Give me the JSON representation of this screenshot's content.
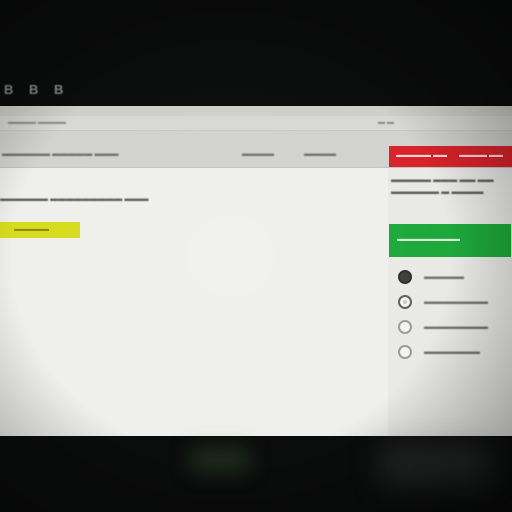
{
  "overlay": {
    "top_text": "B B B"
  },
  "browser": {
    "tabs": [
      "▬▬▬▬ ▬▬▬▬",
      "▬ ▬"
    ]
  },
  "toolbar": {
    "left_label": "▬▬▬▬▬▬ ▬▬▬▬▬ ▬▬▬",
    "mid_label": "▬▬▬▬",
    "right_label": "▬▬▬▬"
  },
  "header_right": {
    "left_text": "▬▬▬▬▬ ▬▬",
    "right_text": "▬▬▬▬ ▬▬"
  },
  "main": {
    "line": "▬▬▬▬▬▬ ▬▬▬▬▬▬▬▬▬ ▬▬▬",
    "highlight": "▬▬▬▬▬"
  },
  "sidebar": {
    "heading_line1": "▬▬▬▬▬ ▬▬▬ ▬▬ ▬▬",
    "heading_line2": "▬▬▬▬▬▬ ▬ ▬▬▬▬",
    "button_label": "▬▬▬▬▬▬▬▬▬",
    "options": [
      "▬▬▬▬▬",
      "▬▬▬▬▬▬▬▬",
      "▬▬▬▬▬▬▬▬",
      "▬▬▬▬▬▬▬"
    ]
  },
  "colors": {
    "accent_red": "#d8232a",
    "accent_green": "#1ea83a",
    "highlight_yellow": "#d7dc1d"
  }
}
